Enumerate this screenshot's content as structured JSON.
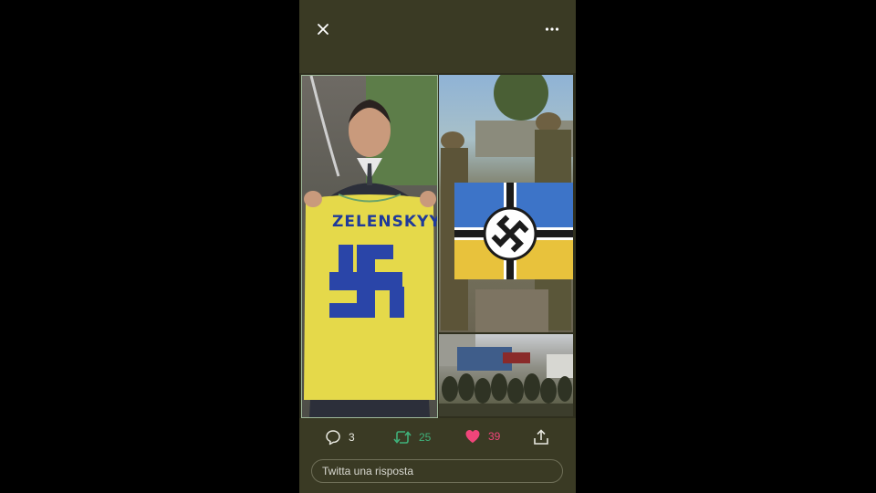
{
  "icons": {
    "close": "close-icon",
    "more": "more-horizontal-icon",
    "reply": "comment-icon",
    "retweet": "retweet-icon",
    "like": "heart-icon",
    "share": "share-icon"
  },
  "colors": {
    "background": "#000000",
    "panel": "#3a3a24",
    "retweet": "#3fb07a",
    "like": "#f0457a",
    "text": "#e8e8e0"
  },
  "media": {
    "left_panel": {
      "shirt_text": "ZELENSKYY"
    }
  },
  "actions": {
    "replies": "3",
    "retweets": "25",
    "likes": "39"
  },
  "reply_box": {
    "placeholder": "Twitta una risposta"
  }
}
